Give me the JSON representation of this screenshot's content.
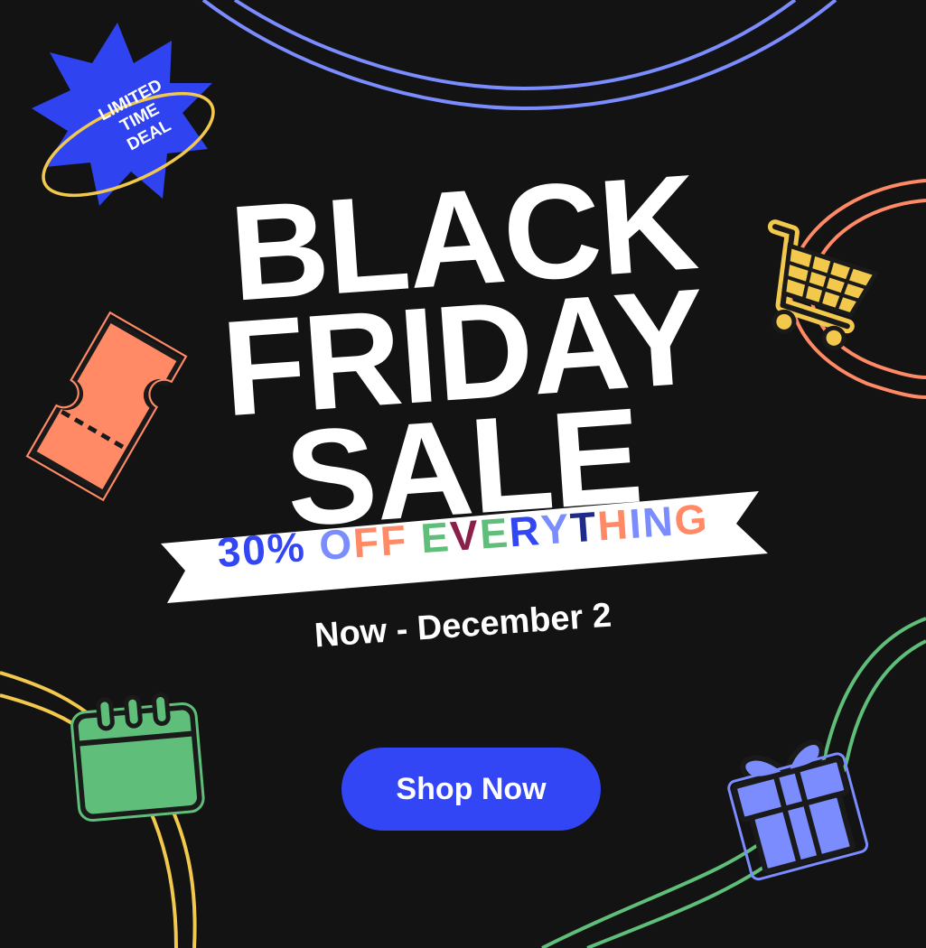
{
  "badge": {
    "lines": [
      "LIMITED",
      "TIME",
      "DEAL"
    ],
    "color": "#2f44f0",
    "ring_color": "#f2c94c"
  },
  "headline": {
    "line1": "BLACK",
    "line2": "FRIDAY",
    "line3": "SALE"
  },
  "ribbon": {
    "segments": [
      {
        "text": "30%",
        "color": "#3346f5"
      },
      {
        "text": " ",
        "color": "#000000"
      },
      {
        "text": "O",
        "color": "#7b8cff"
      },
      {
        "text": "FF",
        "color": "#ff8a65"
      },
      {
        "text": " ",
        "color": "#000000"
      },
      {
        "text": "E",
        "color": "#5fbf7a"
      },
      {
        "text": "V",
        "color": "#8a1f4a"
      },
      {
        "text": "E",
        "color": "#5fbf7a"
      },
      {
        "text": "R",
        "color": "#3346f5"
      },
      {
        "text": "Y",
        "color": "#7b8cff"
      },
      {
        "text": "T",
        "color": "#1f2a8a"
      },
      {
        "text": "H",
        "color": "#ff8a65"
      },
      {
        "text": "IN",
        "color": "#7b8cff"
      },
      {
        "text": "G",
        "color": "#ff8a65"
      }
    ]
  },
  "date_text": "Now - December 2",
  "cta": {
    "label": "Shop Now",
    "color": "#3346f5"
  },
  "icons": {
    "ticket": {
      "name": "ticket-icon",
      "color": "#ff8a65"
    },
    "cart": {
      "name": "shopping-cart-icon",
      "color": "#f2c94c"
    },
    "calendar": {
      "name": "calendar-icon",
      "color": "#5fbf7a"
    },
    "gift": {
      "name": "gift-icon",
      "color": "#7b8cff"
    }
  },
  "colors": {
    "background": "#131313",
    "text": "#ffffff",
    "ribbon_bg": "#ffffff"
  }
}
